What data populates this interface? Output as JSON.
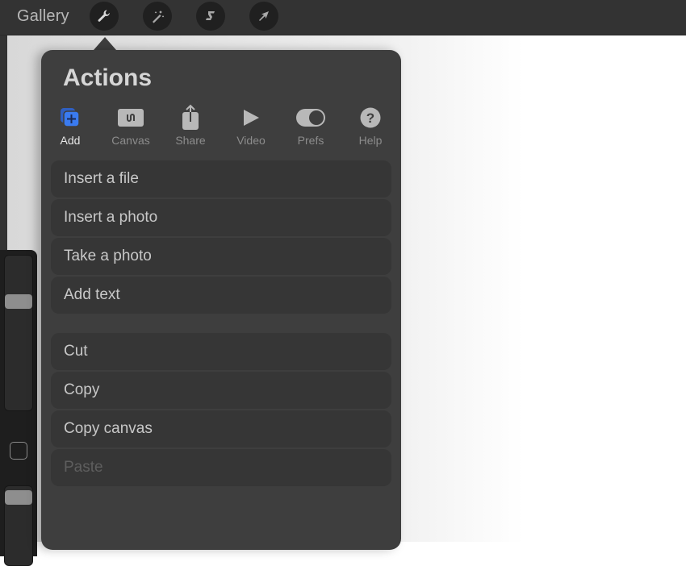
{
  "topbar": {
    "gallery_label": "Gallery",
    "tools": [
      {
        "name": "actions",
        "icon": "wrench-icon",
        "active": true
      },
      {
        "name": "adjustments",
        "icon": "magic-wand-icon",
        "active": false
      },
      {
        "name": "selection",
        "icon": "selection-s-icon",
        "active": false
      },
      {
        "name": "transform",
        "icon": "arrow-cursor-icon",
        "active": false
      }
    ]
  },
  "panel": {
    "title": "Actions",
    "tabs": [
      {
        "label": "Add",
        "icon": "add-layers-icon",
        "active": true
      },
      {
        "label": "Canvas",
        "icon": "canvas-icon",
        "active": false
      },
      {
        "label": "Share",
        "icon": "share-icon",
        "active": false
      },
      {
        "label": "Video",
        "icon": "play-icon",
        "active": false
      },
      {
        "label": "Prefs",
        "icon": "toggle-icon",
        "active": false
      },
      {
        "label": "Help",
        "icon": "help-icon",
        "active": false
      }
    ],
    "group1": [
      {
        "label": "Insert a file",
        "enabled": true
      },
      {
        "label": "Insert a photo",
        "enabled": true
      },
      {
        "label": "Take a photo",
        "enabled": true
      },
      {
        "label": "Add text",
        "enabled": true
      }
    ],
    "group2": [
      {
        "label": "Cut",
        "enabled": true
      },
      {
        "label": "Copy",
        "enabled": true
      },
      {
        "label": "Copy canvas",
        "enabled": true
      },
      {
        "label": "Paste",
        "enabled": false
      }
    ]
  },
  "colors": {
    "accent": "#3a7bf0",
    "panel_bg": "#3e3e3e",
    "menu_item_bg": "#363636",
    "topbar_bg": "#333333"
  }
}
